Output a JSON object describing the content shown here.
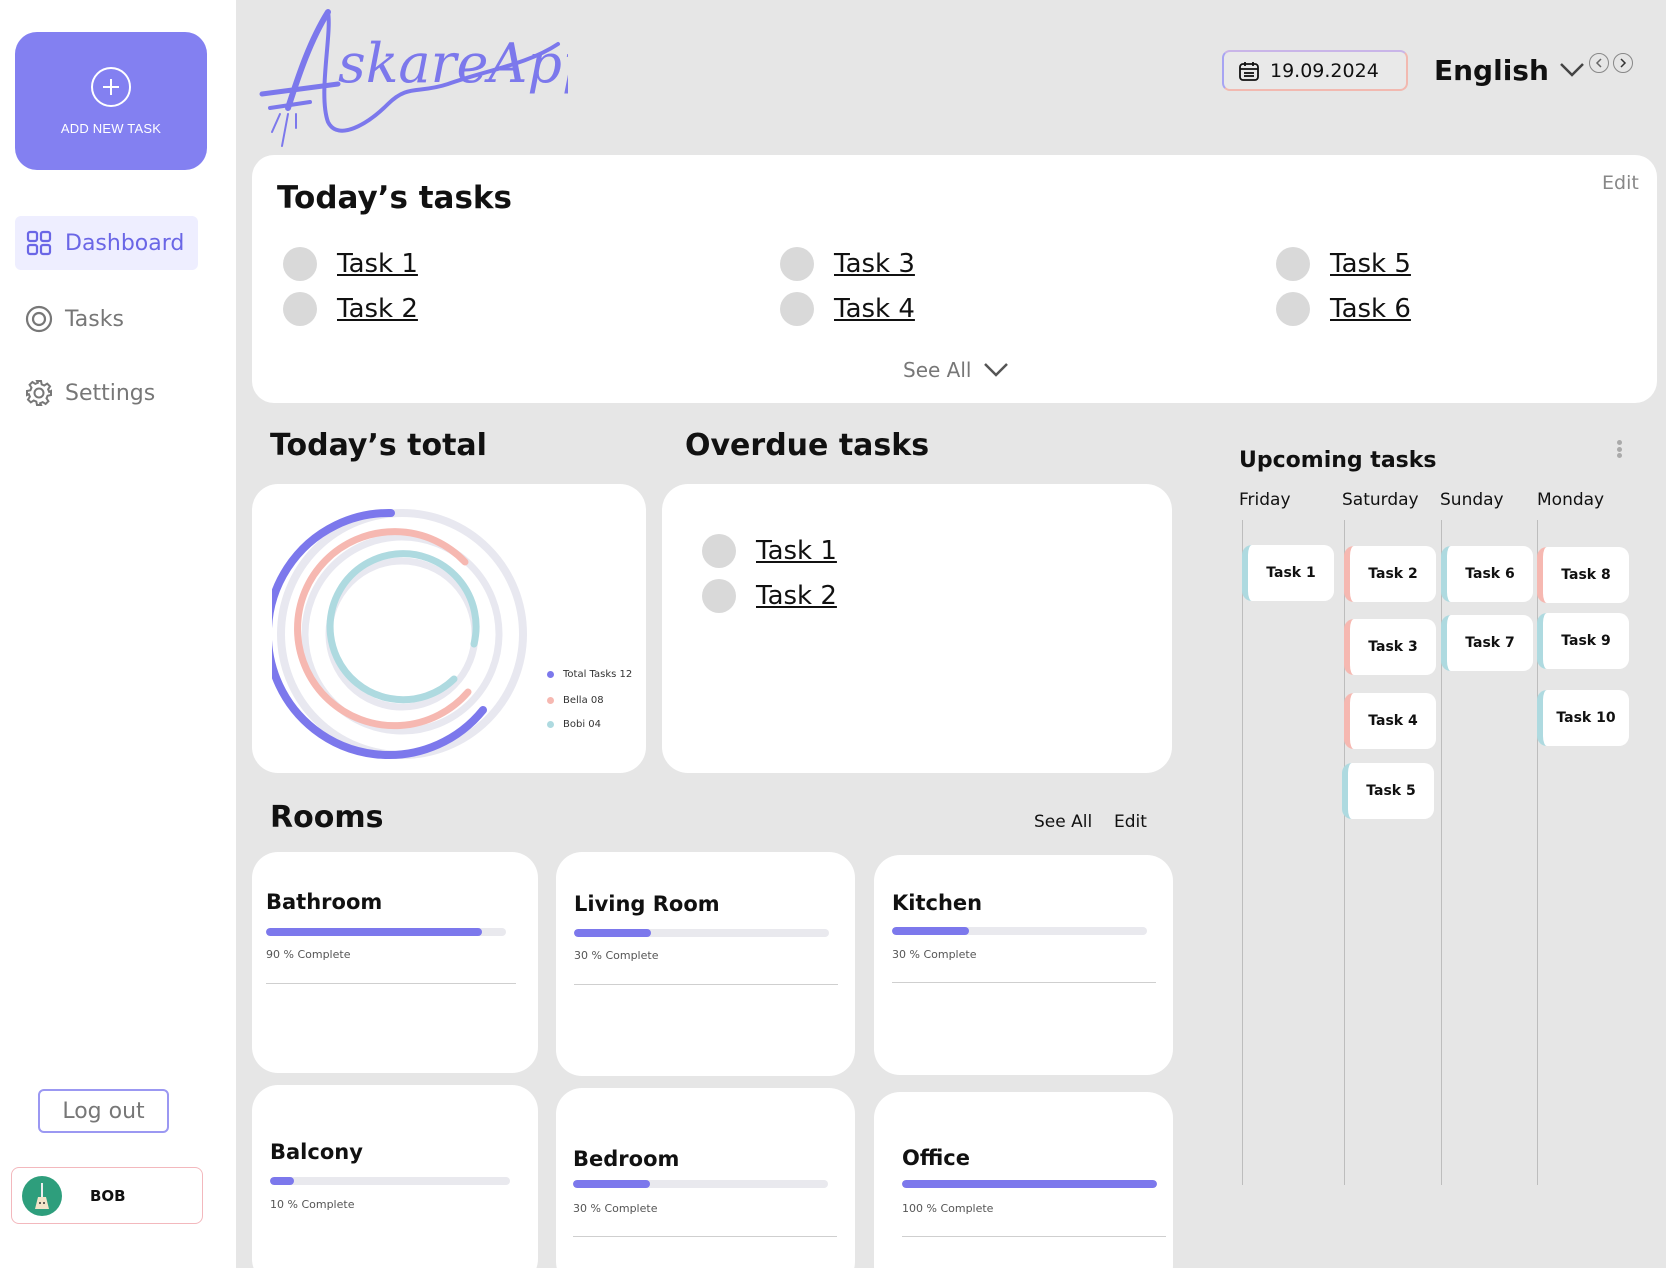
{
  "sidebar": {
    "add_task_label": "ADD NEW TASK",
    "nav": [
      {
        "label": "Dashboard",
        "icon": "grid-icon",
        "active": true
      },
      {
        "label": "Tasks",
        "icon": "target-icon",
        "active": false
      },
      {
        "label": "Settings",
        "icon": "gear-icon",
        "active": false
      }
    ],
    "logout_label": "Log out",
    "user_name": "BOB"
  },
  "header": {
    "logo_text": "SkareAppi",
    "date": "19.09.2024",
    "language": "English"
  },
  "today": {
    "title": "Today’s tasks",
    "edit_label": "Edit",
    "tasks": [
      "Task 1",
      "Task 2",
      "Task 3",
      "Task 4",
      "Task 5",
      "Task 6"
    ],
    "see_all_label": "See All"
  },
  "total": {
    "title": "Today’s total",
    "legend": [
      {
        "label": "Total Tasks 12",
        "color": "#7c78ec"
      },
      {
        "label": "Bella 08",
        "color": "#f6b8b1"
      },
      {
        "label": "Bobi 04",
        "color": "#aedae0"
      }
    ]
  },
  "overdue": {
    "title": "Overdue tasks",
    "tasks": [
      "Task 1",
      "Task 2"
    ]
  },
  "upcoming": {
    "title": "Upcoming tasks",
    "days": [
      {
        "name": "Friday",
        "tasks": [
          "Task 1"
        ]
      },
      {
        "name": "Saturday",
        "tasks": [
          "Task 2",
          "Task 3",
          "Task 4",
          "Task 5"
        ]
      },
      {
        "name": "Sunday",
        "tasks": [
          "Task 6",
          "Task 7"
        ]
      },
      {
        "name": "Monday",
        "tasks": [
          "Task 8",
          "Task 9",
          "Task 10"
        ]
      }
    ]
  },
  "rooms": {
    "title": "Rooms",
    "see_all_label": "See All",
    "edit_label": "Edit",
    "items": [
      {
        "name": "Bathroom",
        "progress": 0.9,
        "label": "90 % Complete"
      },
      {
        "name": "Living Room",
        "progress": 0.3,
        "label": "30 % Complete"
      },
      {
        "name": "Kitchen",
        "progress": 0.3,
        "label": "30 % Complete"
      },
      {
        "name": "Balcony",
        "progress": 0.1,
        "label": "10 % Complete"
      },
      {
        "name": "Bedroom",
        "progress": 0.3,
        "label": "30 % Complete"
      },
      {
        "name": "Office",
        "progress": 1.0,
        "label": "100 % Complete"
      }
    ]
  },
  "colors": {
    "accent": "#7c78ec",
    "pink": "#f6b8b1",
    "teal": "#aedae0",
    "background": "#e6e6e6"
  }
}
